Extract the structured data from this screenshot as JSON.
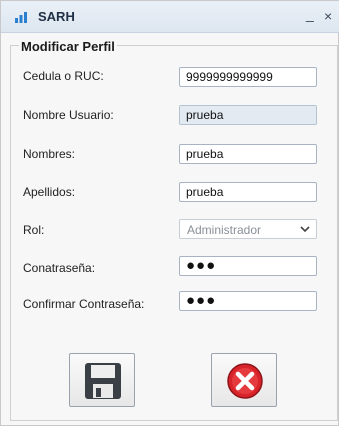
{
  "window": {
    "title": "SARH",
    "minimize_glyph": "_",
    "close_glyph": "×"
  },
  "form": {
    "legend": "Modificar Perfil",
    "fields": {
      "cedula": {
        "label": "Cedula o RUC:",
        "value": "9999999999999"
      },
      "usuario": {
        "label": "Nombre Usuario:",
        "value": "prueba"
      },
      "nombres": {
        "label": "Nombres:",
        "value": "prueba"
      },
      "apellidos": {
        "label": "Apellidos:",
        "value": "prueba"
      },
      "rol": {
        "label": "Rol:",
        "value": "Administrador"
      },
      "contrasena": {
        "label": "Conatraseña:",
        "value": "●●●"
      },
      "confirmar": {
        "label": "Confirmar Contraseña:",
        "value": "●●●"
      }
    }
  },
  "buttons": {
    "save_icon": "floppy-disk-icon",
    "cancel_icon": "red-x-circle-icon"
  },
  "colors": {
    "cancel_red": "#d8232a",
    "floppy_dark": "#3a3f45",
    "title_bar": "#dde6f0"
  }
}
